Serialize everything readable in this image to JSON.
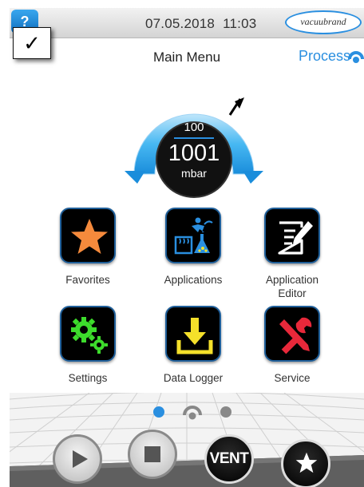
{
  "status_bar": {
    "help_label": "?",
    "date": "07.05.2018",
    "time": "11:03",
    "brand": "vacuubrand"
  },
  "header": {
    "title": "Main Menu",
    "process_label": "Process",
    "check_mark": "✓"
  },
  "gauge": {
    "setpoint": "100",
    "value": "1001",
    "unit": "mbar",
    "accent_color": "#3aaff0"
  },
  "apps": [
    {
      "label": "Favorites",
      "icon": "star-icon"
    },
    {
      "label": "Applications",
      "icon": "applications-icon"
    },
    {
      "label": "Application Editor",
      "icon": "edit-document-icon"
    },
    {
      "label": "Settings",
      "icon": "gears-icon"
    },
    {
      "label": "Data Logger",
      "icon": "download-icon"
    },
    {
      "label": "Service",
      "icon": "tools-icon"
    }
  ],
  "pager": {
    "active_color": "#2a8fe0",
    "inactive_color": "#888888"
  },
  "controls": {
    "play": "play-icon",
    "stop": "stop-icon",
    "vent_label": "VENT",
    "favorite": "star-icon"
  }
}
